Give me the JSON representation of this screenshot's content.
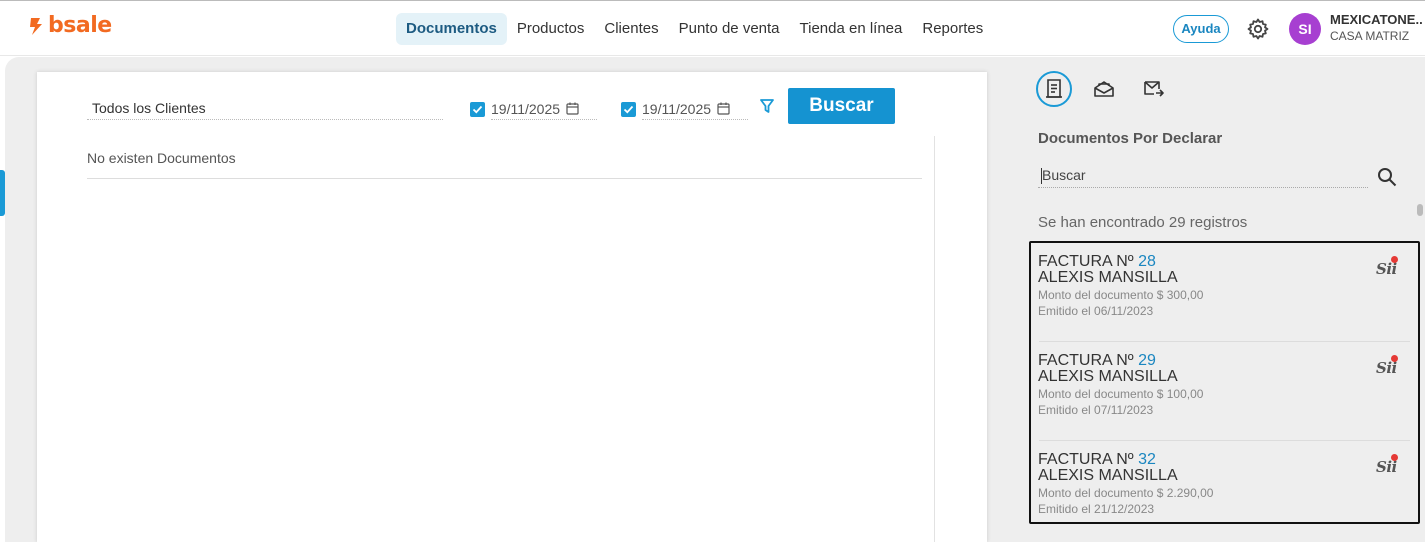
{
  "brand": {
    "name": "bsale",
    "color": "#f26a21"
  },
  "nav": {
    "items": [
      {
        "label": "Documentos",
        "active": true
      },
      {
        "label": "Productos",
        "active": false
      },
      {
        "label": "Clientes",
        "active": false
      },
      {
        "label": "Punto de venta",
        "active": false
      },
      {
        "label": "Tienda en línea",
        "active": false
      },
      {
        "label": "Reportes",
        "active": false
      }
    ]
  },
  "header": {
    "help_label": "Ayuda",
    "avatar_initials": "SI",
    "avatar_color": "#a73fd1",
    "company_name": "MEXICATONE...",
    "branch": "CASA MATRIZ"
  },
  "filters": {
    "client_value": "Todos los Clientes",
    "date_from": "19/11/2025",
    "date_from_checked": true,
    "date_to": "19/11/2025",
    "date_to_checked": true,
    "search_button": "Buscar"
  },
  "results": {
    "empty_message": "No existen Documentos"
  },
  "side": {
    "tabs": [
      {
        "icon": "document-icon",
        "active": true
      },
      {
        "icon": "inbox-icon",
        "active": false
      },
      {
        "icon": "mail-forward-icon",
        "active": false
      }
    ],
    "title": "Documentos Por Declarar",
    "search_placeholder": "Buscar",
    "found_text": "Se han encontrado 29 registros",
    "documents": [
      {
        "type": "FACTURA Nº",
        "number": "28",
        "client": "ALEXIS MANSILLA",
        "amount": "Monto del documento $ 300,00",
        "date": "Emitido el 06/11/2023",
        "badge": "Sii"
      },
      {
        "type": "FACTURA Nº",
        "number": "29",
        "client": "ALEXIS MANSILLA",
        "amount": "Monto del documento $ 100,00",
        "date": "Emitido el 07/11/2023",
        "badge": "Sii"
      },
      {
        "type": "FACTURA Nº",
        "number": "32",
        "client": "ALEXIS MANSILLA",
        "amount": "Monto del documento $ 2.290,00",
        "date": "Emitido el 21/12/2023",
        "badge": "Sii"
      }
    ]
  },
  "colors": {
    "accent": "#1a9ad6",
    "primary_button": "#1593d1",
    "notification": "#e53935"
  }
}
